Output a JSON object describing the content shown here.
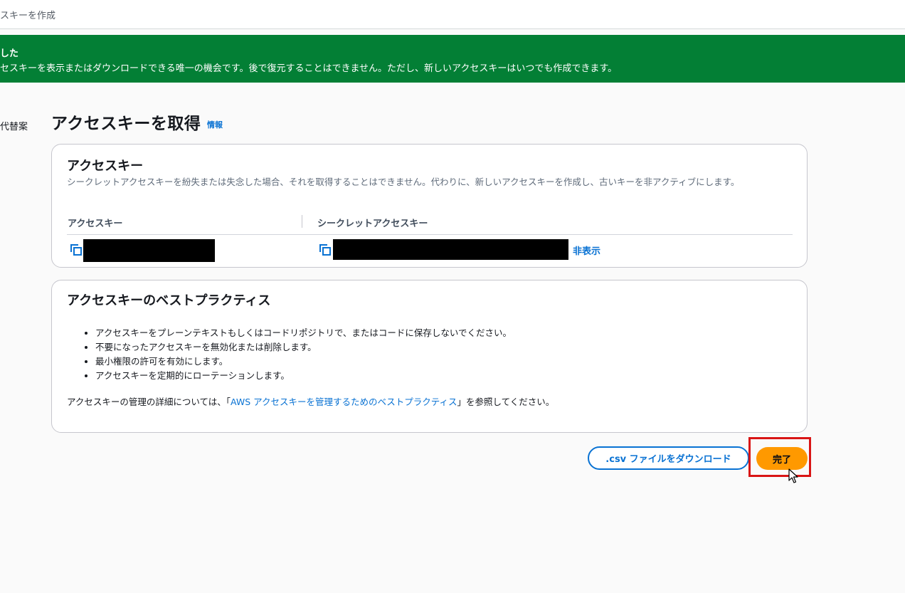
{
  "header": {
    "title": "スキーを作成"
  },
  "flash": {
    "title": "した",
    "message": "セスキーを表示またはダウンロードできる唯一の機会です。後で復元することはできません。ただし、新しいアクセスキーはいつでも作成できます。",
    "color": "#037f35"
  },
  "side": {
    "label": "代替案"
  },
  "page": {
    "title": "アクセスキーを取得",
    "info_link": "情報"
  },
  "access_key_card": {
    "title": "アクセスキー",
    "description": "シークレットアクセスキーを紛失または失念した場合、それを取得することはできません。代わりに、新しいアクセスキーを作成し、古いキーを非アクティブにします。",
    "columns": [
      "アクセスキー",
      "シークレットアクセスキー"
    ],
    "hide_link": "非表示",
    "icons": [
      "copy-icon",
      "copy-icon"
    ]
  },
  "best_practices_card": {
    "title": "アクセスキーのベストプラクティス",
    "items": [
      "アクセスキーをプレーンテキストもしくはコードリポジトリで、またはコードに保存しないでください。",
      "不要になったアクセスキーを無効化または削除します。",
      "最小権限の許可を有効にします。",
      "アクセスキーを定期的にローテーションします。"
    ],
    "paragraph_before": "アクセスキーの管理の詳細については、「",
    "paragraph_link": "AWS アクセスキーを管理するためのベストプラクティス",
    "paragraph_after": "」を参照してください。"
  },
  "actions": {
    "download_csv": ".csv ファイルをダウンロード",
    "done": "完了",
    "primary_color": "#ff9900",
    "link_color": "#0972d3",
    "highlight_color": "#d91515"
  }
}
